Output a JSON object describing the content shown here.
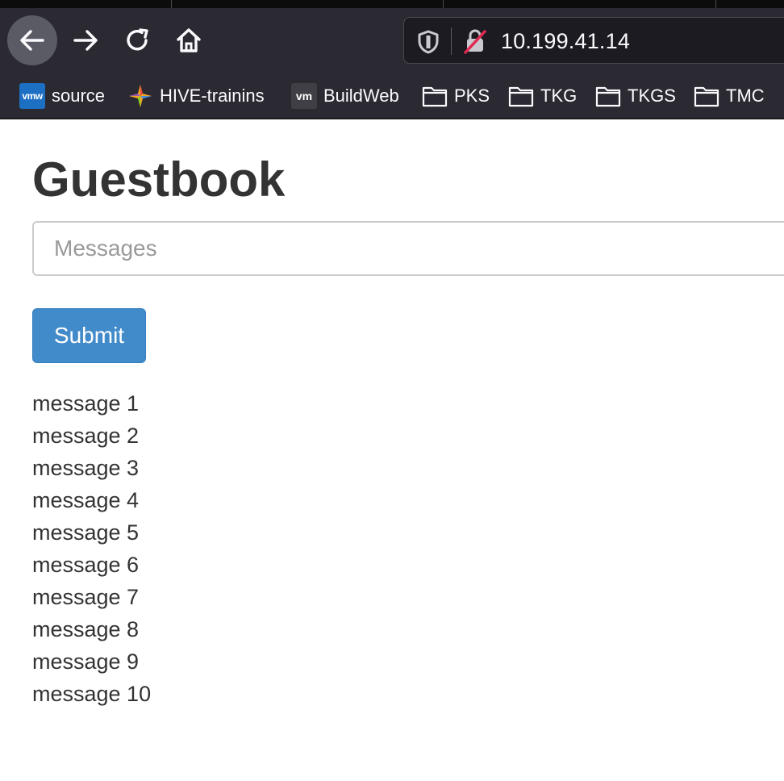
{
  "browser": {
    "url": "10.199.41.14",
    "bookmarks": [
      {
        "label": "source",
        "icon": "vmw-favicon",
        "icon_text": "vmw"
      },
      {
        "label": "HIVE-trainins",
        "icon": "hive-favicon"
      },
      {
        "label": "BuildWeb",
        "icon": "vm-favicon",
        "icon_text": "vm"
      },
      {
        "label": "PKS",
        "icon": "folder-icon"
      },
      {
        "label": "TKG",
        "icon": "folder-icon"
      },
      {
        "label": "TKGS",
        "icon": "folder-icon"
      },
      {
        "label": "TMC",
        "icon": "folder-icon"
      }
    ],
    "toolbar_color": "#2b2a33"
  },
  "page": {
    "title": "Guestbook",
    "input_placeholder": "Messages",
    "input_value": "",
    "submit_label": "Submit",
    "button_color": "#428bca",
    "messages": [
      "message 1",
      "message 2",
      "message 3",
      "message 4",
      "message 5",
      "message 6",
      "message 7",
      "message 8",
      "message 9",
      "message 10"
    ]
  }
}
